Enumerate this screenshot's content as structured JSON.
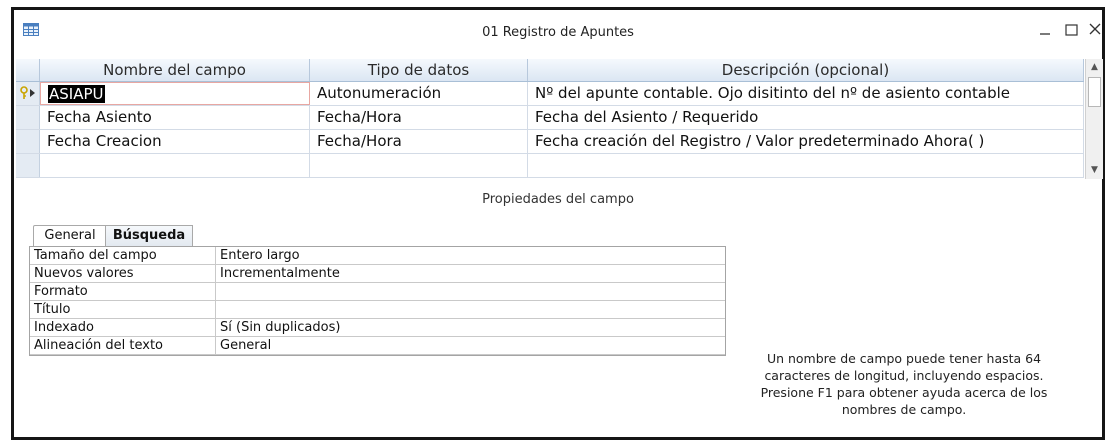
{
  "window": {
    "title": "01 Registro de Apuntes",
    "icon": "table-icon",
    "controls": {
      "minimize": "minimize-icon",
      "maximize": "maximize-icon",
      "close": "close-icon"
    }
  },
  "grid": {
    "headers": [
      "Nombre del campo",
      "Tipo de datos",
      "Descripción (opcional)"
    ],
    "rows": [
      {
        "name": "ASIAPU",
        "type": "Autonumeración",
        "description": "Nº del apunte contable. Ojo disitinto del nº de asiento contable",
        "primary_key": true
      },
      {
        "name": "Fecha Asiento",
        "type": "Fecha/Hora",
        "description": "Fecha del Asiento / Requerido"
      },
      {
        "name": "Fecha Creacion",
        "type": "Fecha/Hora",
        "description": "Fecha creación del Registro / Valor predeterminado Ahora( )"
      },
      {
        "name": "",
        "type": "",
        "description": ""
      }
    ]
  },
  "properties": {
    "title": "Propiedades del campo",
    "tabs": [
      "General",
      "Búsqueda"
    ],
    "active_tab": "General",
    "rows": [
      {
        "label": "Tamaño del campo",
        "value": "Entero largo"
      },
      {
        "label": "Nuevos valores",
        "value": "Incrementalmente"
      },
      {
        "label": "Formato",
        "value": ""
      },
      {
        "label": "Título",
        "value": ""
      },
      {
        "label": "Indexado",
        "value": "Sí (Sin duplicados)"
      },
      {
        "label": "Alineación del texto",
        "value": "General"
      }
    ],
    "help": "Un nombre de campo puede tener hasta 64 caracteres de longitud, incluyendo espacios. Presione F1 para obtener ayuda acerca de los nombres de campo."
  },
  "colors": {
    "header_bg": "#dbe6f3",
    "selector_bg": "#e4ebf3",
    "active_border": "#e8a7a2"
  }
}
